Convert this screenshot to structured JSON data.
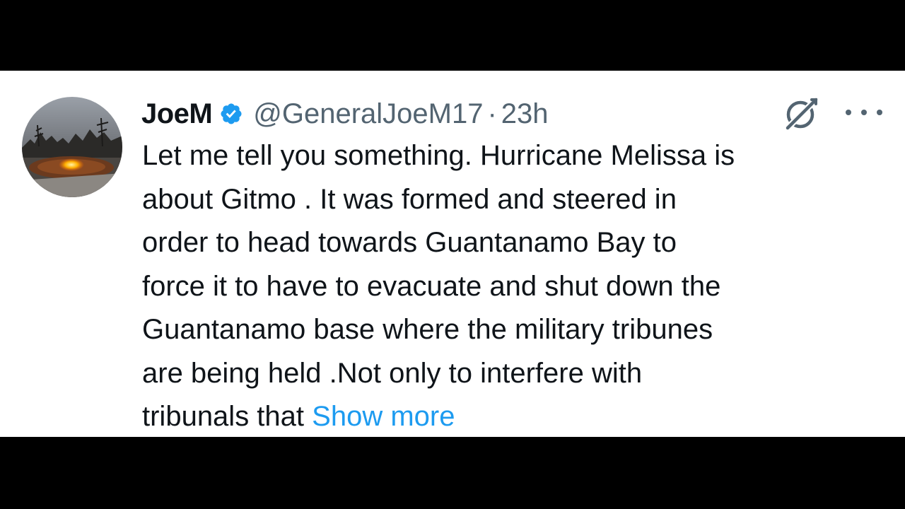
{
  "tweet": {
    "display_name": "JoeM",
    "verified": true,
    "handle": "@GeneralJoeM17",
    "separator": "·",
    "time": "23h",
    "avatar_description": "avatar",
    "lines": [
      "Let me tell you something. Hurricane Melissa is",
      "about Gitmo . It was formed and steered in",
      "order to head towards Guantanamo Bay to",
      "force it to have to evacuate and shut down the",
      "Guantanamo base where the military tribunes",
      "are being held .Not only to interfere with",
      "tribunals that "
    ],
    "show_more": "Show more"
  },
  "colors": {
    "letterbox": "#000000",
    "background": "#ffffff",
    "text": "#0f1419",
    "muted": "#536471",
    "accent": "#1d9bf0",
    "verified_badge": "#1d9bf0"
  },
  "icons": {
    "verified": "verified-badge-icon",
    "grok": "grok-icon",
    "more": "more-options-icon"
  }
}
